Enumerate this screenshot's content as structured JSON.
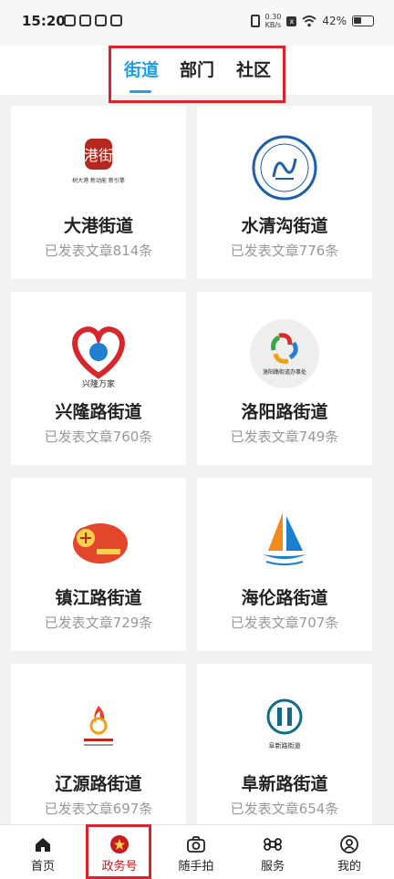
{
  "status": {
    "time": "15:20",
    "net_speed_top": "0.30",
    "net_speed_bottom": "KB/s",
    "battery": "42%",
    "x_badge": "x"
  },
  "tabs": [
    {
      "label": "街道",
      "active": true
    },
    {
      "label": "部门",
      "active": false
    },
    {
      "label": "社区",
      "active": false
    }
  ],
  "cards": [
    {
      "name": "大港街道",
      "count": "已发表文章814条",
      "logo_text": "树大港 新动能 新引擎"
    },
    {
      "name": "水清沟街道",
      "count": "已发表文章776条"
    },
    {
      "name": "兴隆路街道",
      "count": "已发表文章760条",
      "logo_text": "兴隆万家"
    },
    {
      "name": "洛阳路街道",
      "count": "已发表文章749条",
      "logo_text": "洛阳路街道办事处"
    },
    {
      "name": "镇江路街道",
      "count": "已发表文章729条"
    },
    {
      "name": "海伦路街道",
      "count": "已发表文章707条"
    },
    {
      "name": "辽源路街道",
      "count": "已发表文章697条"
    },
    {
      "name": "阜新路街道",
      "count": "已发表文章654条",
      "logo_text": "阜新路街道"
    }
  ],
  "nav": [
    {
      "label": "首页",
      "icon": "home-icon"
    },
    {
      "label": "政务号",
      "icon": "emblem-icon",
      "active": true
    },
    {
      "label": "随手拍",
      "icon": "camera-icon"
    },
    {
      "label": "服务",
      "icon": "command-icon"
    },
    {
      "label": "我的",
      "icon": "user-icon"
    }
  ],
  "colors": {
    "accent": "#1f9ee6",
    "highlight": "#d9232d",
    "nav_active": "#c51d1d"
  }
}
